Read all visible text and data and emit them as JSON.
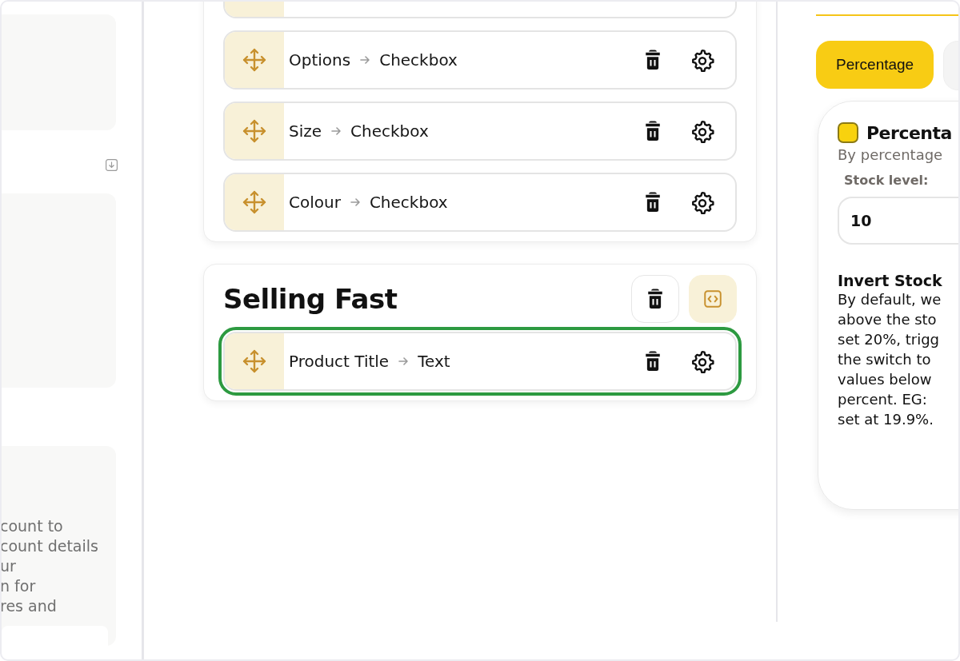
{
  "left_panel": {
    "description_lines": [
      "count to",
      "count details",
      "ur",
      "n for",
      "res and"
    ]
  },
  "sections": [
    {
      "rows": [
        {
          "field": "Options",
          "type": "Checkbox",
          "selected": false
        },
        {
          "field": "Size",
          "type": "Checkbox",
          "selected": false
        },
        {
          "field": "Colour",
          "type": "Checkbox",
          "selected": false
        }
      ]
    },
    {
      "title": "Selling Fast",
      "rows": [
        {
          "field": "Product Title",
          "type": "Text",
          "selected": true
        }
      ]
    }
  ],
  "right_panel": {
    "tabs": [
      {
        "label": "Percentage",
        "selected": true
      }
    ],
    "card": {
      "title": "Percenta",
      "subtitle": "By percentage",
      "field_label": "Stock level:",
      "field_value": "10",
      "heading": "Invert Stock",
      "lines": [
        "By default, we",
        "above the sto",
        "set 20%, trigg",
        "the switch to",
        "values below",
        "percent. EG:",
        "set at 19.9%."
      ]
    }
  }
}
